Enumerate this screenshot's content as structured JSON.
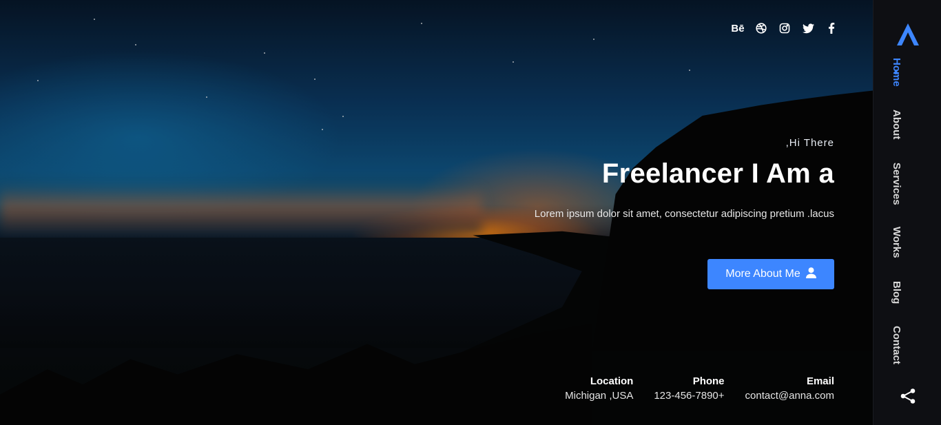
{
  "social": {
    "behance_label": "Bē",
    "icons": [
      "behance-icon",
      "dribbble-icon",
      "instagram-icon",
      "twitter-icon",
      "facebook-icon"
    ]
  },
  "hero": {
    "greeting": ",Hi There",
    "headline": "Freelancer  I Am a",
    "description": "Lorem ipsum dolor sit amet, consectetur adipiscing pretium .lacus",
    "cta_label": "More About Me"
  },
  "contact": {
    "location_label": "Location",
    "location_value": "Michigan ,USA",
    "phone_label": "Phone",
    "phone_value": "123-456-7890+",
    "email_label": "Email",
    "email_value": "contact@anna.com"
  },
  "nav": {
    "items": [
      "Home",
      "About",
      "Services",
      "Works",
      "Blog",
      "Contact"
    ],
    "active": "Home"
  },
  "colors": {
    "accent": "#3d86ff",
    "sidebar_bg": "#0e0f13"
  }
}
